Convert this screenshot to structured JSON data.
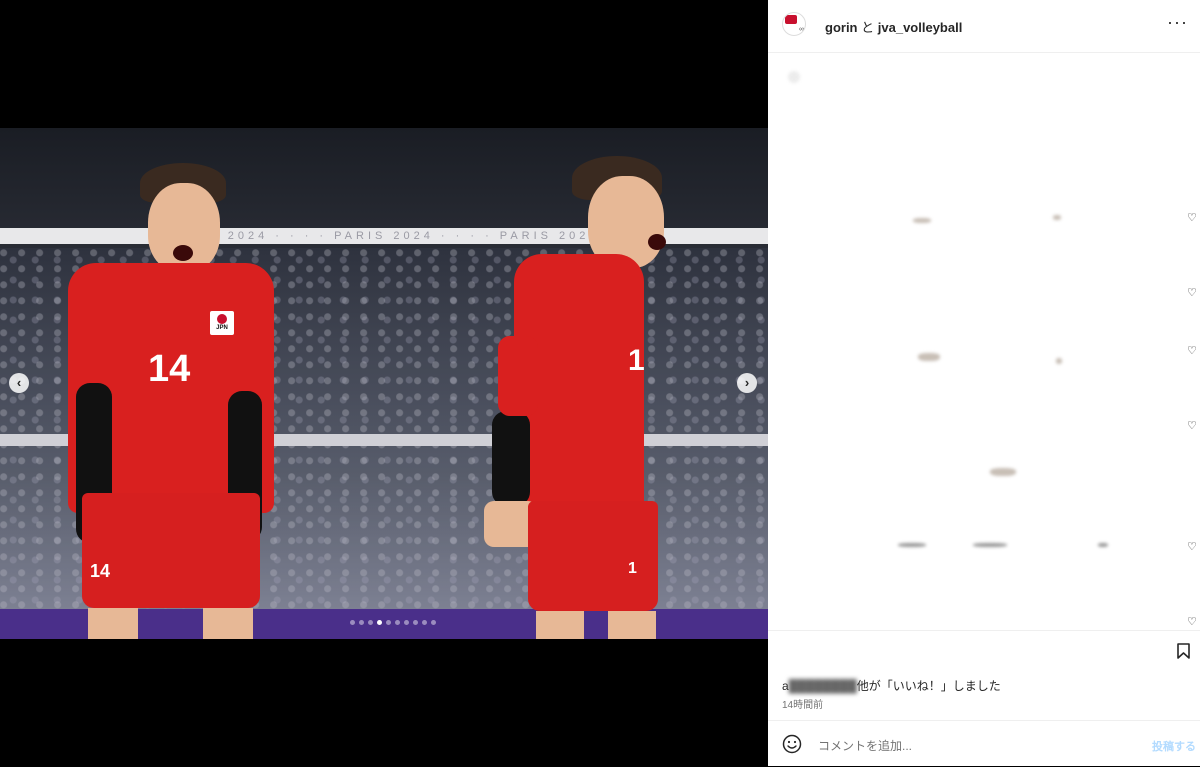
{
  "post": {
    "author_primary": "gorin",
    "author_connector": "と",
    "author_secondary": "jva_volleyball",
    "more_icon": "more-horizontal-icon"
  },
  "media": {
    "jersey_numbers": [
      "14",
      "1"
    ],
    "side_numbers": [
      "14",
      "1"
    ],
    "jersey_tag": "JPN",
    "slide_count": 10,
    "active_slide": 3
  },
  "engagement": {
    "likes_prefix": "a",
    "likes_text": "他が「いいね！」しました",
    "time_ago": "14時間前"
  },
  "composer": {
    "placeholder": "コメントを追加...",
    "post_label": "投稿する"
  },
  "colors": {
    "accent_red": "#d9201f",
    "post_blue": "#b3dbff"
  }
}
